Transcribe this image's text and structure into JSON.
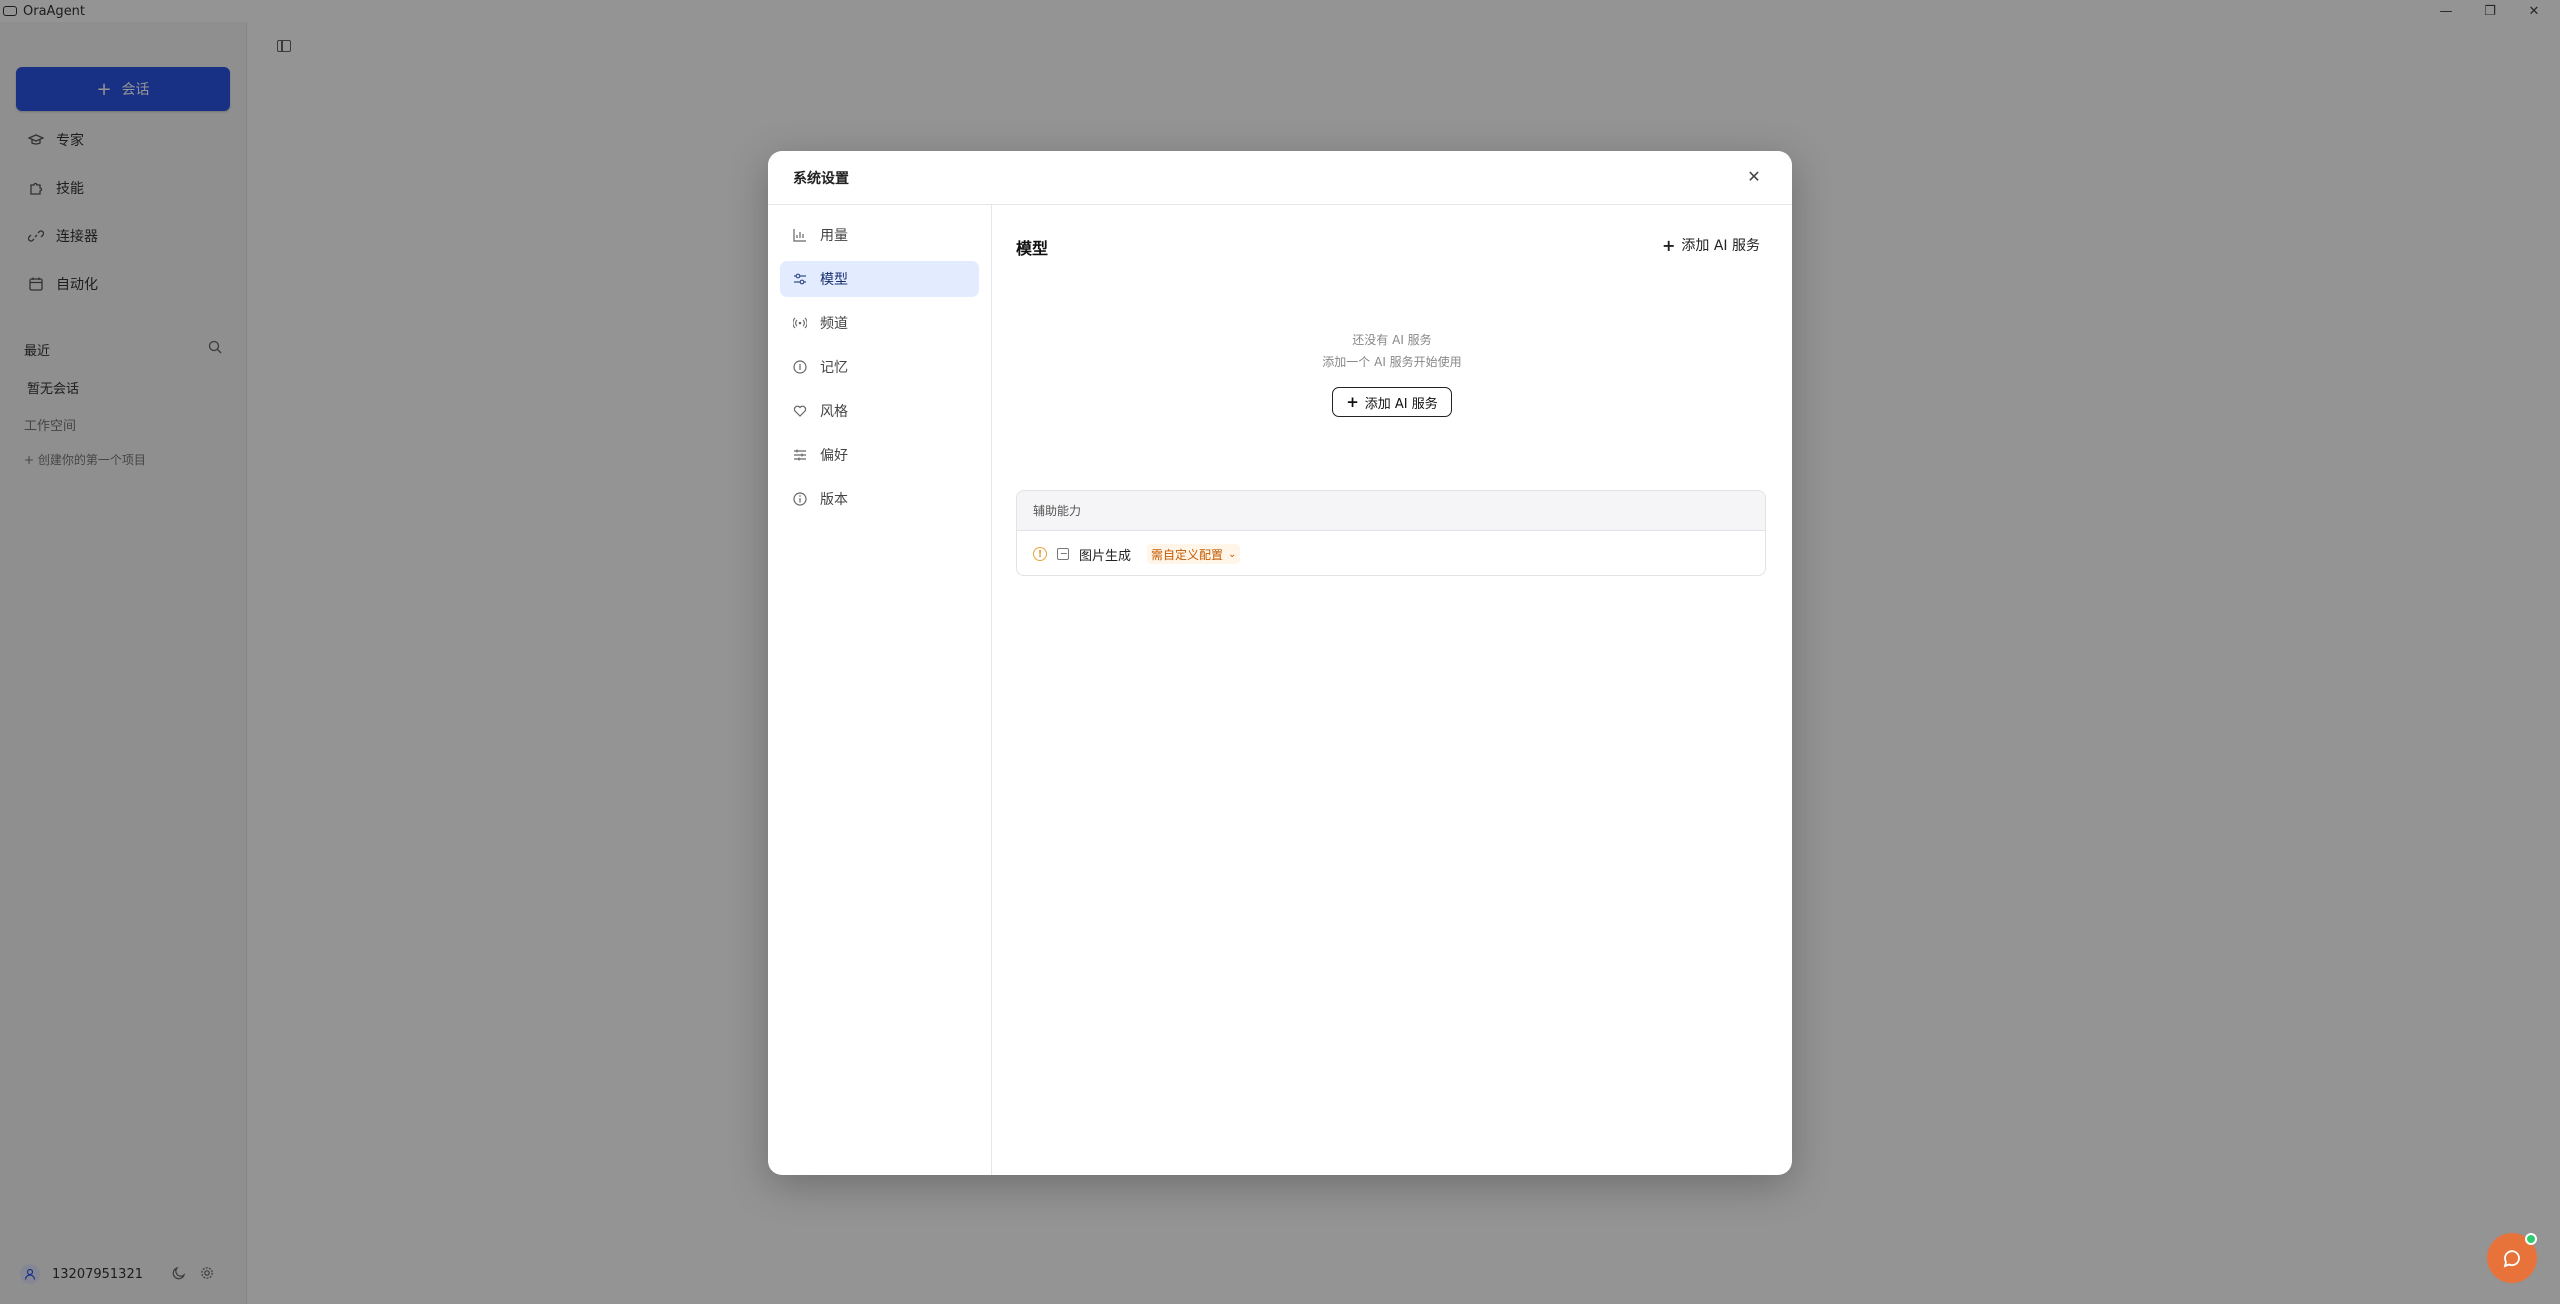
{
  "window": {
    "title": "OraAgent",
    "minimize": "—",
    "restore": "❐",
    "close": "✕"
  },
  "sidebar": {
    "new_chat_label": "会话",
    "nav": [
      {
        "label": "专家",
        "icon": "graduation-cap-icon"
      },
      {
        "label": "技能",
        "icon": "puzzle-icon"
      },
      {
        "label": "连接器",
        "icon": "link-icon"
      },
      {
        "label": "自动化",
        "icon": "calendar-icon"
      }
    ],
    "recent_label": "最近",
    "empty_chats": "暂无会话",
    "workspace_label": "工作空间",
    "create_project": "+ 创建你的第一个项目",
    "user_phone": "13207951321"
  },
  "modal": {
    "title": "系统设置",
    "nav": [
      {
        "label": "用量",
        "icon": "bar-chart-icon"
      },
      {
        "label": "模型",
        "icon": "sliders-icon"
      },
      {
        "label": "频道",
        "icon": "radio-icon"
      },
      {
        "label": "记忆",
        "icon": "info-circle-icon"
      },
      {
        "label": "风格",
        "icon": "heart-icon"
      },
      {
        "label": "偏好",
        "icon": "tune-icon"
      },
      {
        "label": "版本",
        "icon": "info-icon"
      }
    ],
    "active_nav": "模型",
    "content": {
      "title": "模型",
      "add_ai_service": "添加 AI 服务",
      "empty_line1": "还没有 AI 服务",
      "empty_line2": "添加一个 AI 服务开始使用",
      "add_ai_service_center": "添加 AI 服务",
      "aux_section": {
        "title": "辅助能力",
        "items": [
          {
            "name": "图片生成",
            "status": "需自定义配置"
          }
        ]
      }
    }
  },
  "colors": {
    "accent": "#2c55e6",
    "active_nav_bg": "#e3ecff",
    "warning": "#e9a23b",
    "status_text": "#c35a00",
    "chat_fab": "#e8733a"
  }
}
